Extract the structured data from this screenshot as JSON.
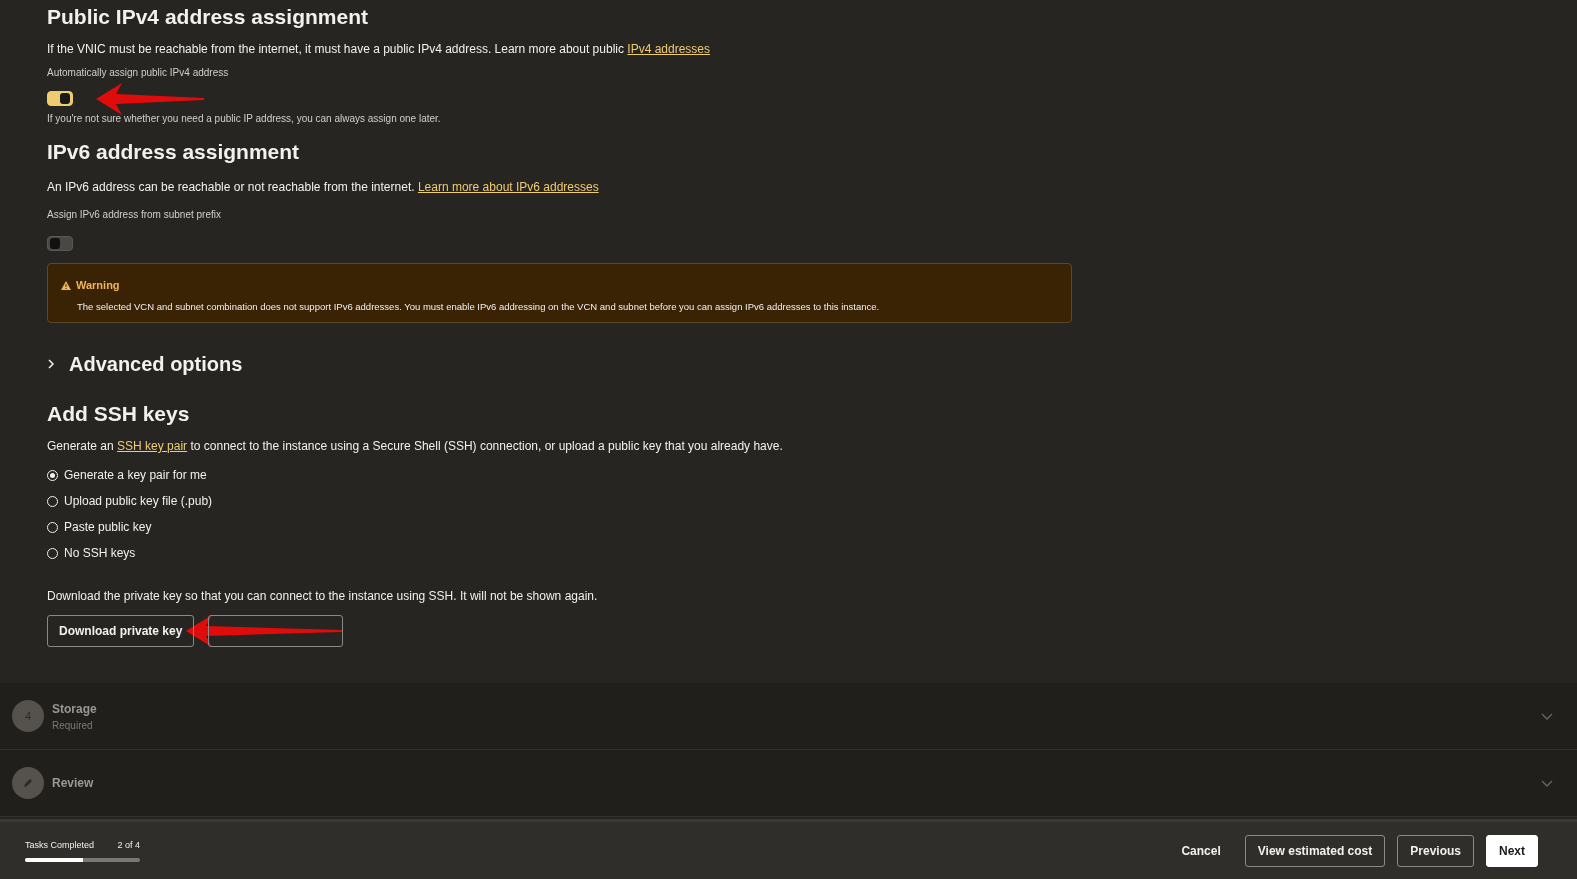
{
  "ipv4": {
    "title": "Public IPv4 address assignment",
    "description": "If the VNIC must be reachable from the internet, it must have a public IPv4 address. Learn more about public",
    "link": "IPv4 addresses",
    "toggle_label": "Automatically assign public IPv4 address",
    "on": true,
    "hint": "If you're not sure whether you need a public IP address, you can always assign one later."
  },
  "ipv6": {
    "title": "IPv6 address assignment",
    "description": "An IPv6 address can be reachable or not reachable from the internet.",
    "link": "Learn more about IPv6 addresses",
    "toggle_label": "Assign IPv6 address from subnet prefix",
    "on": false
  },
  "warning": {
    "title": "Warning",
    "message": "The selected VCN and subnet combination does not support IPv6 addresses. You must enable IPv6 addressing on the VCN and subnet before you can assign IPv6 addresses to this instance."
  },
  "advanced": {
    "label": "Advanced options",
    "expanded": false
  },
  "ssh": {
    "title": "Add SSH keys",
    "description_before": "Generate an",
    "link": "SSH key pair",
    "description_after": "to connect to the instance using a Secure Shell (SSH) connection, or upload a public key that you already have.",
    "options": [
      {
        "label": "Generate a key pair for me",
        "selected": true
      },
      {
        "label": "Upload public key file (.pub)",
        "selected": false
      },
      {
        "label": "Paste public key",
        "selected": false
      },
      {
        "label": "No SSH keys",
        "selected": false
      }
    ],
    "download_note": "Download the private key so that you can connect to the instance using SSH. It will not be shown again.",
    "download_button": "Download private key"
  },
  "steps": [
    {
      "kind": "number",
      "number": "4",
      "title": "Storage",
      "subtitle": "Required",
      "expanded": false
    },
    {
      "kind": "edit",
      "title": "Review",
      "expanded": false
    }
  ],
  "footer": {
    "tasks_label": "Tasks Completed",
    "tasks_count": "2 of 4",
    "level": 0.5,
    "buttons": [
      {
        "kind": "text",
        "label": "Cancel"
      },
      {
        "kind": "outline",
        "label": "View estimated cost"
      },
      {
        "kind": "outline",
        "label": "Previous"
      },
      {
        "kind": "primary",
        "label": "Next"
      }
    ]
  }
}
